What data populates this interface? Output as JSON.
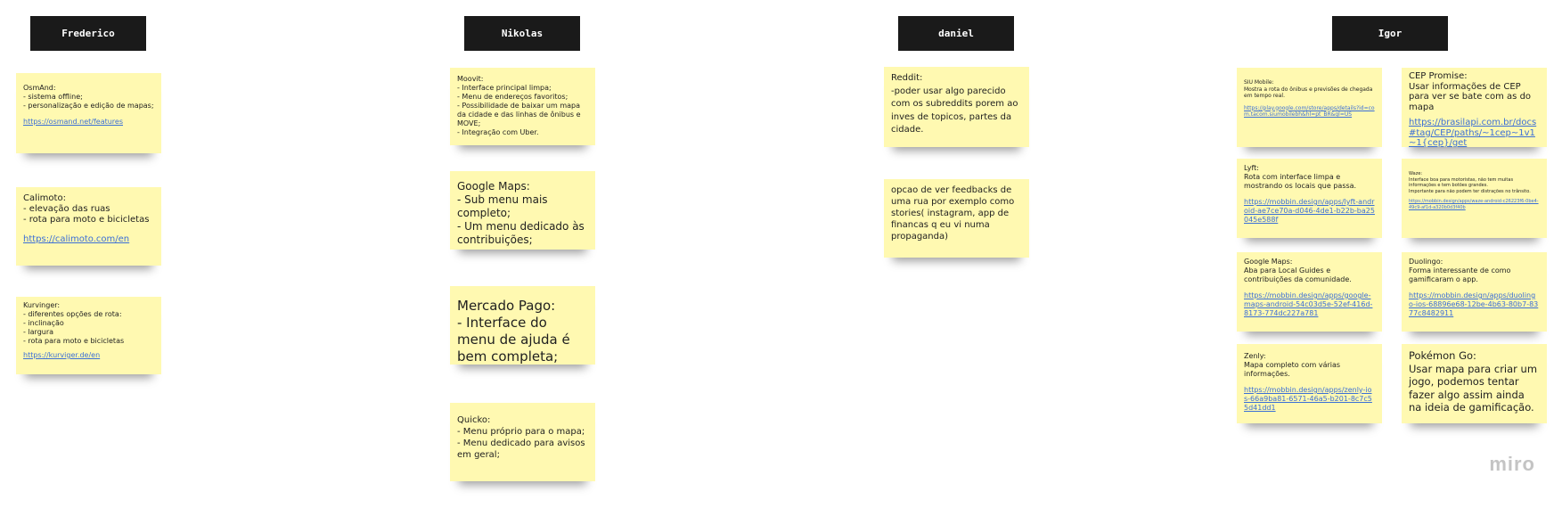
{
  "columns": [
    {
      "header": "Frederico",
      "notes": [
        {
          "title": "OsmAnd:",
          "lines": [
            "- sistema offline;",
            "- personalização e edição de mapas;"
          ],
          "link": "https://osmand.net/features"
        },
        {
          "title": "Calimoto:",
          "lines": [
            "- elevação das ruas",
            "- rota para moto e bicicletas"
          ],
          "link": "https://calimoto.com/en"
        },
        {
          "title": "Kurvinger:",
          "lines": [
            "- diferentes opções de rota:",
            "- inclinação",
            "- largura",
            "- rota para moto e bicicletas"
          ],
          "link": "https://kurviger.de/en"
        }
      ]
    },
    {
      "header": "Nikolas",
      "notes": [
        {
          "title": "Moovit:",
          "lines": [
            "- Interface principal limpa;",
            "- Menu de endereços favoritos;",
            "- Possibilidade de baixar um mapa da cidade e das linhas de ônibus e MOVE;",
            "- Integração com Uber."
          ]
        },
        {
          "title": "Google Maps:",
          "lines": [
            "- Sub menu mais completo;",
            "- Um menu dedicado às contribuições;"
          ]
        },
        {
          "title": "Mercado Pago:",
          "lines": [
            "- Interface do menu de ajuda é bem completa;"
          ]
        },
        {
          "title": "Quicko:",
          "lines": [
            "- Menu próprio para o mapa;",
            "- Menu dedicado para avisos em geral;"
          ]
        }
      ]
    },
    {
      "header": "daniel",
      "notes": [
        {
          "title": "Reddit:",
          "lines": [
            "-poder usar algo parecido com os subreddits porem ao inves de topicos, partes da cidade."
          ]
        },
        {
          "title": "",
          "lines": [
            "opcao de ver feedbacks de uma rua por exemplo como stories( instagram, app de financas q eu vi numa propaganda)"
          ]
        }
      ]
    },
    {
      "header": "Igor",
      "notes": [
        {
          "title": "SIU Mobile:",
          "lines": [
            "Mostra a rota do ônibus e previsões de chegada em tempo real."
          ],
          "link": "https://play.google.com/store/apps/details?id=com.tacom.siumobilebh&hl=pt_BR&gl=US"
        },
        {
          "title": "CEP Promise:",
          "lines": [
            "Usar informações de CEP para ver se bate com as do mapa"
          ],
          "link": "https://brasilapi.com.br/docs#tag/CEP/paths/~1cep~1v1~1{cep}/get"
        },
        {
          "title": "Lyft:",
          "lines": [
            "Rota com interface limpa e mostrando os locais que passa."
          ],
          "link": "https://mobbin.design/apps/lyft-android-ae7ce70a-d046-4de1-b22b-ba25045e588f"
        },
        {
          "title": "Waze:",
          "lines": [
            "Interface boa para motoristas, não tem muitas informações e tem botões grandes.",
            "Importante para não podem ter distrações no trânsito."
          ],
          "link": "https://mobbin.design/apps/waze-android-c26223f6-0be4-49c9-af1d-a320b0d3f40b"
        },
        {
          "title": "Google Maps:",
          "lines": [
            "Aba para Local Guides e contribuições da comunidade."
          ],
          "link": "https://mobbin.design/apps/google-maps-android-54c03d5e-52ef-416d-8173-774dc227a781"
        },
        {
          "title": "Duolingo:",
          "lines": [
            "Forma interessante de como gamificaram o app."
          ],
          "link": "https://mobbin.design/apps/duolingo-ios-68896e68-12be-4b63-80b7-8377c8482911"
        },
        {
          "title": "Zenly:",
          "lines": [
            "Mapa completo com várias informações."
          ],
          "link": "https://mobbin.design/apps/zenly-ios-66a9ba81-6571-46a5-b201-8c7c55d41dd1"
        },
        {
          "title": "Pokémon Go:",
          "lines": [
            "Usar mapa para criar um jogo, podemos tentar fazer algo assim ainda na ideia de gamificação."
          ]
        }
      ]
    }
  ],
  "brand": "miro",
  "colors": {
    "note": "#fff9b1",
    "header": "#1a1a1a",
    "link": "#3b6fd6"
  }
}
